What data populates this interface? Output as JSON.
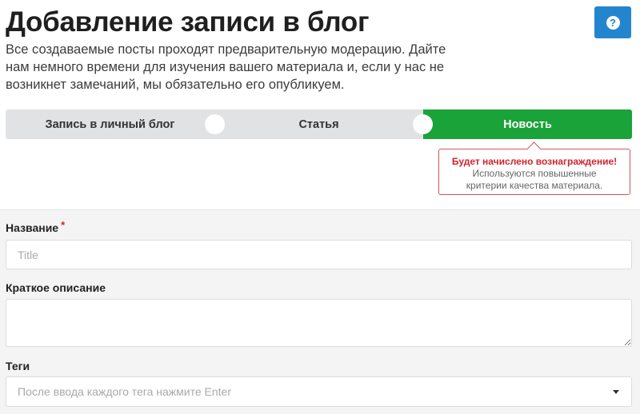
{
  "header": {
    "title": "Добавление записи в блог",
    "intro": "Все создаваемые посты проходят предварительную модерацию. Дайте нам немного времени для изучения вашего материала и, если у нас не возникнет замечаний, мы обязательно его опубликуем.",
    "help_icon": "question-circle-icon",
    "help_glyph": "?"
  },
  "post_type": {
    "options": [
      {
        "label": "Запись в личный блог"
      },
      {
        "label": "Статья"
      },
      {
        "label": "Новость"
      }
    ],
    "selected_index": 2,
    "selected_color": "#1aa338"
  },
  "reward_tooltip": {
    "title": "Будет начислено вознаграждение!",
    "text_line1": "Используются повышенные",
    "text_line2": "критерии качества материала."
  },
  "form": {
    "title_label": "Название",
    "required_mark": "*",
    "title_placeholder": "Title",
    "title_value": "",
    "summary_label": "Краткое описание",
    "summary_value": "",
    "tags_label": "Теги",
    "tags_placeholder": "После ввода каждого тега нажмите Enter",
    "tags_icon": "caret-down-icon"
  },
  "colors": {
    "help_button": "#2485cf",
    "accent_red": "#d0242c",
    "selector_bg": "#e1e2e4",
    "form_bg": "#f4f4f4"
  }
}
